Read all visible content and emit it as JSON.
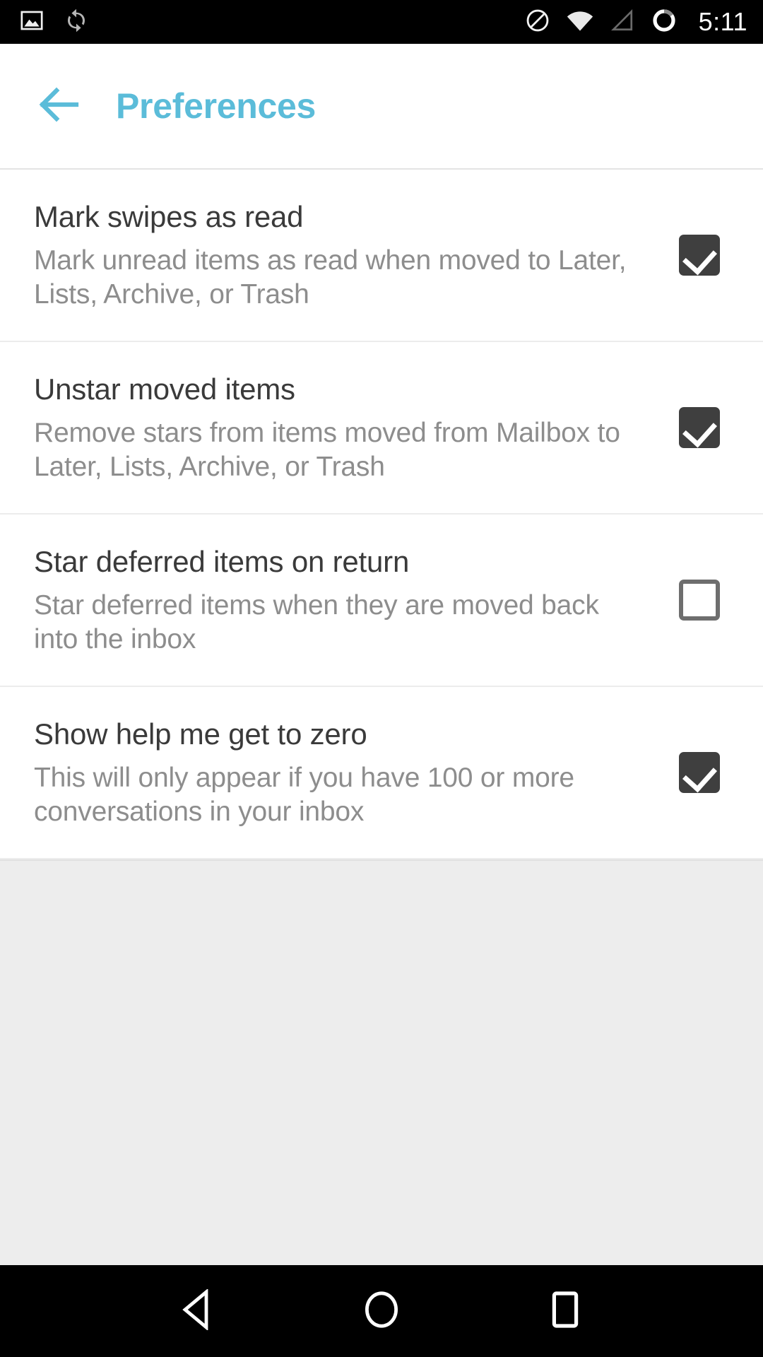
{
  "status_bar": {
    "left_icons": [
      {
        "name": "screenshot-icon",
        "label": "screenshot"
      },
      {
        "name": "sync-icon",
        "label": "sync"
      }
    ],
    "right_icons": [
      {
        "name": "do-not-disturb-icon",
        "label": "do not disturb"
      },
      {
        "name": "wifi-icon",
        "label": "wifi"
      },
      {
        "name": "cellular-signal-icon",
        "label": "cellular signal"
      },
      {
        "name": "battery-icon",
        "label": "battery"
      }
    ],
    "clock": "5:11"
  },
  "app_bar": {
    "back_label": "Back",
    "title": "Preferences",
    "title_color": "#5bbcd9"
  },
  "preferences": [
    {
      "title": "Mark swipes as read",
      "summary": "Mark unread items as read when moved to Later, Lists, Archive, or Trash",
      "checked": true
    },
    {
      "title": "Unstar moved items",
      "summary": "Remove stars from items moved from Mailbox to Later, Lists, Archive, or Trash",
      "checked": true
    },
    {
      "title": "Star deferred items on return",
      "summary": "Star deferred items when they are moved back into the inbox",
      "checked": false
    },
    {
      "title": "Show help me get to zero",
      "summary": "This will only appear if you have 100 or more conversations in your inbox",
      "checked": true
    }
  ],
  "nav_bar": {
    "back": "Back",
    "home": "Home",
    "recents": "Recent apps"
  },
  "colors": {
    "accent": "#5bbcd9",
    "title_text": "#3a3a3a",
    "summary_text": "#8d8d8d",
    "checkbox_on": "#3f3f3f",
    "checkbox_off": "#6e6e6e",
    "page_background": "#ededed",
    "card_background": "#ffffff",
    "system_bar": "#000000"
  }
}
